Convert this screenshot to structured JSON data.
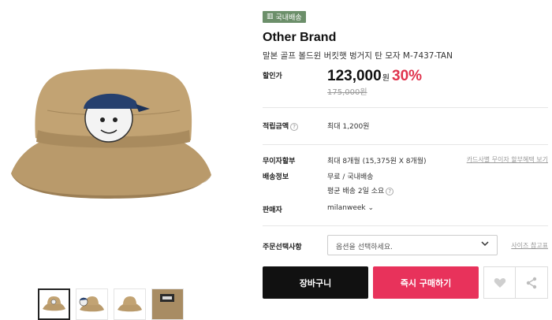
{
  "gallery": {
    "main_alt": "Khaki bucket hat with golf ball character patch",
    "thumb_count": 4
  },
  "badge": {
    "label": "국내배송"
  },
  "product": {
    "brand": "Other Brand",
    "name": "말본 골프 볼드윈 버킷햇 벙거지 탄 모자 M-7437-TAN"
  },
  "price": {
    "label": "할인가",
    "sale": "123,000",
    "currency": "원",
    "discount": "30%",
    "original": "175,000원"
  },
  "points": {
    "label": "적립금액",
    "value": "최대 1,200원"
  },
  "installment": {
    "label": "무이자할부",
    "value": "최대 8개월 (15,375원 X 8개월)",
    "link": "카드사별 무이자 할부혜택 보기"
  },
  "shipping": {
    "label": "배송정보",
    "value": "무료 / 국내배송",
    "average": "평균 배송 2일 소요"
  },
  "seller": {
    "label": "판매자",
    "value": "milanweek"
  },
  "option": {
    "label": "주문선택사항",
    "placeholder": "옵션을 선택하세요.",
    "size_link": "사이즈 참고표"
  },
  "actions": {
    "cart": "장바구니",
    "buy": "즉시 구매하기"
  },
  "colors": {
    "accent_red": "#e0334d",
    "buy_button": "#e8325b",
    "badge_green": "#6c8f6a"
  }
}
